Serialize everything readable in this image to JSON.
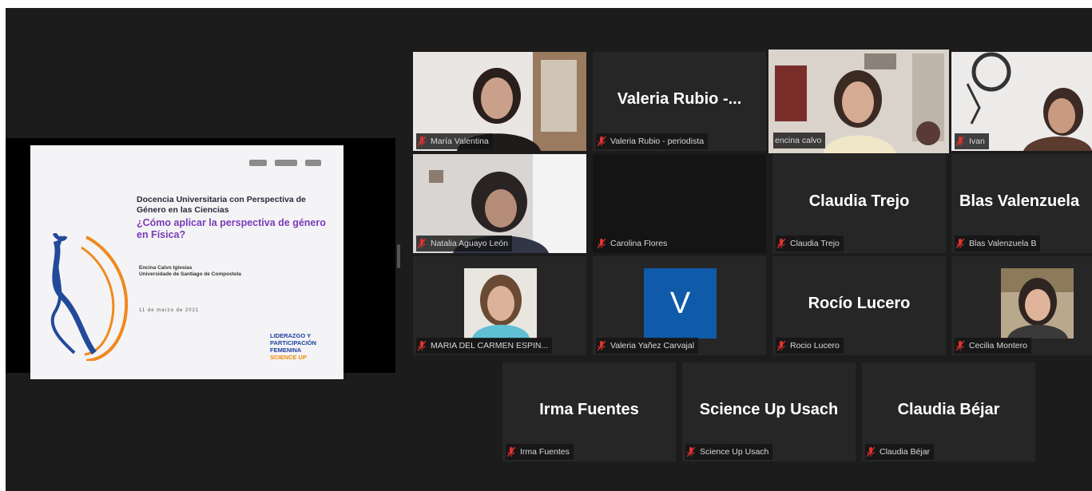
{
  "slide": {
    "title": "Docencia Universitaria con Perspectiva de Género en las Ciencias",
    "subtitle": "¿Cómo aplicar la perspectiva de género en Física?",
    "author": "Encina Calvo Iglesias",
    "affiliation": "Universidade de Santiago de Compostela",
    "date": "11 de marzo de 2021",
    "brand_line1": "LIDERAZGO Y",
    "brand_line2": "PARTICIPACIÓN",
    "brand_line3": "FEMENINA",
    "brand_line4": "SCIENCE UP"
  },
  "participants": [
    {
      "id": "p1",
      "name": "María Valentina",
      "video": true
    },
    {
      "id": "p2",
      "name": "Valeria Rubio - periodista",
      "display": "Valeria Rubio -..."
    },
    {
      "id": "p3",
      "name": "encina calvo",
      "video": true,
      "active_speaker": true
    },
    {
      "id": "p4",
      "name": "Ivan",
      "video": true
    },
    {
      "id": "p5",
      "name": "Natalia Aguayo León",
      "video": true
    },
    {
      "id": "p6",
      "name": "Carolina Flores"
    },
    {
      "id": "p7",
      "name": "Claudia Trejo",
      "display": "Claudia Trejo"
    },
    {
      "id": "p8",
      "name": "Blas Valenzuela B",
      "display": "Blas Valenzuela"
    },
    {
      "id": "p9",
      "name": "MARIA DEL CARMEN ESPIN...",
      "avatar": "photo"
    },
    {
      "id": "p10",
      "name": "Valeria Yañez Carvajal",
      "avatar": "letter",
      "letter": "V"
    },
    {
      "id": "p11",
      "name": "Rocio Lucero",
      "display": "Rocío Lucero"
    },
    {
      "id": "p12",
      "name": "Cecilia Montero",
      "avatar": "photo"
    },
    {
      "id": "p13",
      "name": "Irma Fuentes",
      "display": "Irma Fuentes"
    },
    {
      "id": "p14",
      "name": "Science Up Usach",
      "display": "Science Up Usach"
    },
    {
      "id": "p15",
      "name": "Claudia Béjar",
      "display": "Claudia Béjar"
    }
  ],
  "colors": {
    "background": "#1c1c1c",
    "tile": "#262626",
    "active_border": "#d7e84a",
    "muted_mic": "#e0332f",
    "avatar_blue": "#0f5aa9"
  },
  "icons": {
    "muted": "mic-muted-icon"
  }
}
